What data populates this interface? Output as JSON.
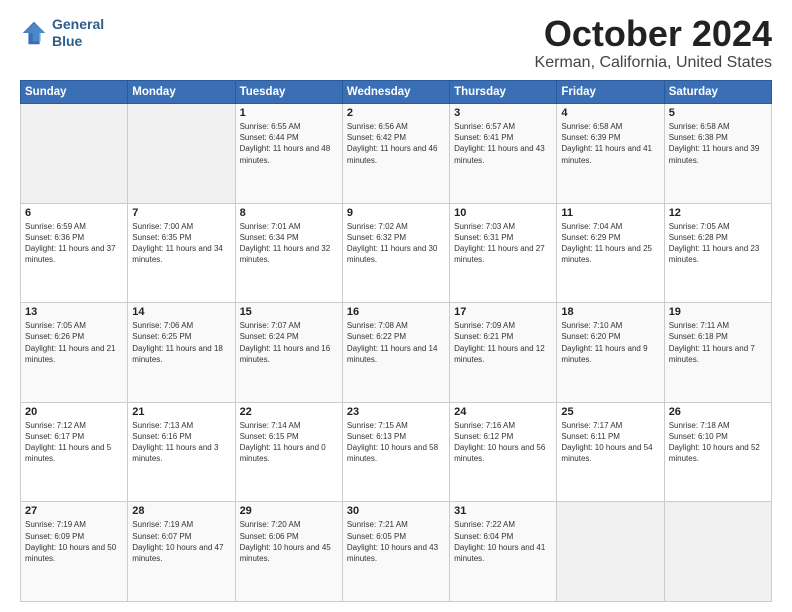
{
  "logo": {
    "line1": "General",
    "line2": "Blue"
  },
  "title": "October 2024",
  "subtitle": "Kerman, California, United States",
  "days_of_week": [
    "Sunday",
    "Monday",
    "Tuesday",
    "Wednesday",
    "Thursday",
    "Friday",
    "Saturday"
  ],
  "weeks": [
    [
      {
        "day": "",
        "info": ""
      },
      {
        "day": "",
        "info": ""
      },
      {
        "day": "1",
        "info": "Sunrise: 6:55 AM\nSunset: 6:44 PM\nDaylight: 11 hours and 48 minutes."
      },
      {
        "day": "2",
        "info": "Sunrise: 6:56 AM\nSunset: 6:42 PM\nDaylight: 11 hours and 46 minutes."
      },
      {
        "day": "3",
        "info": "Sunrise: 6:57 AM\nSunset: 6:41 PM\nDaylight: 11 hours and 43 minutes."
      },
      {
        "day": "4",
        "info": "Sunrise: 6:58 AM\nSunset: 6:39 PM\nDaylight: 11 hours and 41 minutes."
      },
      {
        "day": "5",
        "info": "Sunrise: 6:58 AM\nSunset: 6:38 PM\nDaylight: 11 hours and 39 minutes."
      }
    ],
    [
      {
        "day": "6",
        "info": "Sunrise: 6:59 AM\nSunset: 6:36 PM\nDaylight: 11 hours and 37 minutes."
      },
      {
        "day": "7",
        "info": "Sunrise: 7:00 AM\nSunset: 6:35 PM\nDaylight: 11 hours and 34 minutes."
      },
      {
        "day": "8",
        "info": "Sunrise: 7:01 AM\nSunset: 6:34 PM\nDaylight: 11 hours and 32 minutes."
      },
      {
        "day": "9",
        "info": "Sunrise: 7:02 AM\nSunset: 6:32 PM\nDaylight: 11 hours and 30 minutes."
      },
      {
        "day": "10",
        "info": "Sunrise: 7:03 AM\nSunset: 6:31 PM\nDaylight: 11 hours and 27 minutes."
      },
      {
        "day": "11",
        "info": "Sunrise: 7:04 AM\nSunset: 6:29 PM\nDaylight: 11 hours and 25 minutes."
      },
      {
        "day": "12",
        "info": "Sunrise: 7:05 AM\nSunset: 6:28 PM\nDaylight: 11 hours and 23 minutes."
      }
    ],
    [
      {
        "day": "13",
        "info": "Sunrise: 7:05 AM\nSunset: 6:26 PM\nDaylight: 11 hours and 21 minutes."
      },
      {
        "day": "14",
        "info": "Sunrise: 7:06 AM\nSunset: 6:25 PM\nDaylight: 11 hours and 18 minutes."
      },
      {
        "day": "15",
        "info": "Sunrise: 7:07 AM\nSunset: 6:24 PM\nDaylight: 11 hours and 16 minutes."
      },
      {
        "day": "16",
        "info": "Sunrise: 7:08 AM\nSunset: 6:22 PM\nDaylight: 11 hours and 14 minutes."
      },
      {
        "day": "17",
        "info": "Sunrise: 7:09 AM\nSunset: 6:21 PM\nDaylight: 11 hours and 12 minutes."
      },
      {
        "day": "18",
        "info": "Sunrise: 7:10 AM\nSunset: 6:20 PM\nDaylight: 11 hours and 9 minutes."
      },
      {
        "day": "19",
        "info": "Sunrise: 7:11 AM\nSunset: 6:18 PM\nDaylight: 11 hours and 7 minutes."
      }
    ],
    [
      {
        "day": "20",
        "info": "Sunrise: 7:12 AM\nSunset: 6:17 PM\nDaylight: 11 hours and 5 minutes."
      },
      {
        "day": "21",
        "info": "Sunrise: 7:13 AM\nSunset: 6:16 PM\nDaylight: 11 hours and 3 minutes."
      },
      {
        "day": "22",
        "info": "Sunrise: 7:14 AM\nSunset: 6:15 PM\nDaylight: 11 hours and 0 minutes."
      },
      {
        "day": "23",
        "info": "Sunrise: 7:15 AM\nSunset: 6:13 PM\nDaylight: 10 hours and 58 minutes."
      },
      {
        "day": "24",
        "info": "Sunrise: 7:16 AM\nSunset: 6:12 PM\nDaylight: 10 hours and 56 minutes."
      },
      {
        "day": "25",
        "info": "Sunrise: 7:17 AM\nSunset: 6:11 PM\nDaylight: 10 hours and 54 minutes."
      },
      {
        "day": "26",
        "info": "Sunrise: 7:18 AM\nSunset: 6:10 PM\nDaylight: 10 hours and 52 minutes."
      }
    ],
    [
      {
        "day": "27",
        "info": "Sunrise: 7:19 AM\nSunset: 6:09 PM\nDaylight: 10 hours and 50 minutes."
      },
      {
        "day": "28",
        "info": "Sunrise: 7:19 AM\nSunset: 6:07 PM\nDaylight: 10 hours and 47 minutes."
      },
      {
        "day": "29",
        "info": "Sunrise: 7:20 AM\nSunset: 6:06 PM\nDaylight: 10 hours and 45 minutes."
      },
      {
        "day": "30",
        "info": "Sunrise: 7:21 AM\nSunset: 6:05 PM\nDaylight: 10 hours and 43 minutes."
      },
      {
        "day": "31",
        "info": "Sunrise: 7:22 AM\nSunset: 6:04 PM\nDaylight: 10 hours and 41 minutes."
      },
      {
        "day": "",
        "info": ""
      },
      {
        "day": "",
        "info": ""
      }
    ]
  ]
}
